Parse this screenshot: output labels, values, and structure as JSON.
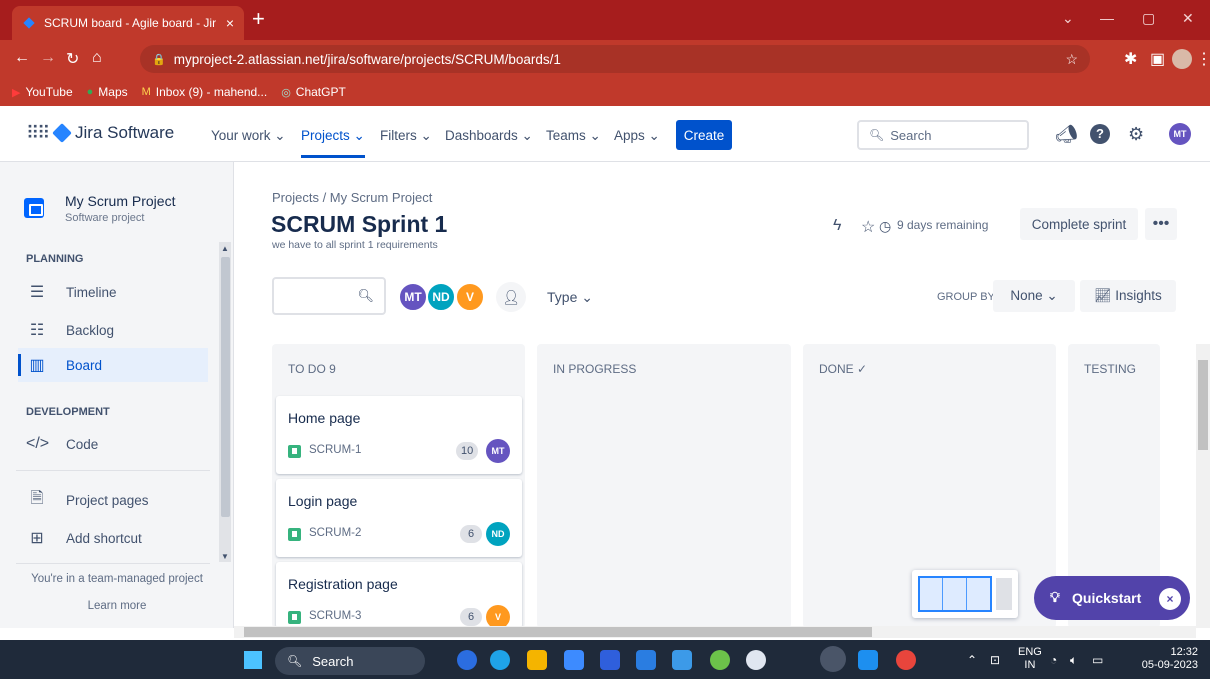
{
  "browser": {
    "tab_title": "SCRUM board - Agile board - Jir",
    "tab_close": "×",
    "new_tab": "+",
    "url": "myproject-2.atlassian.net/jira/software/projects/SCRUM/boards/1",
    "bookmarks": [
      "YouTube",
      "Maps",
      "Inbox (9) - mahend...",
      "ChatGPT"
    ]
  },
  "jira_nav": {
    "product": "Jira Software",
    "items": [
      "Your work ⌄",
      "Projects ⌄",
      "Filters ⌄",
      "Dashboards ⌄",
      "Teams ⌄",
      "Apps ⌄"
    ],
    "create": "Create",
    "search_placeholder": "Search",
    "user_initials": "MT"
  },
  "sidebar": {
    "project_name": "My Scrum Project",
    "project_type": "Software project",
    "planning_header": "PLANNING",
    "timeline": "Timeline",
    "backlog": "Backlog",
    "board": "Board",
    "development_header": "DEVELOPMENT",
    "code": "Code",
    "project_pages": "Project pages",
    "add_shortcut": "Add shortcut",
    "team_note": "You're in a team-managed project",
    "learn_more": "Learn more"
  },
  "board": {
    "breadcrumb": "Projects / My Scrum Project",
    "title": "SCRUM Sprint 1",
    "goal": "we have to all sprint 1 requirements",
    "remaining": "9 days remaining",
    "complete_sprint": "Complete sprint",
    "more": "•••",
    "avatars": [
      "MT",
      "ND",
      "V"
    ],
    "type_filter": "Type ⌄",
    "group_by_label": "GROUP BY",
    "group_by_value": "None ⌄",
    "insights": "Insights",
    "columns": [
      {
        "title": "TO DO 9"
      },
      {
        "title": "IN PROGRESS"
      },
      {
        "title": "DONE ✓"
      },
      {
        "title": "TESTING"
      }
    ],
    "cards": [
      {
        "title": "Home page",
        "key": "SCRUM-1",
        "points": "10",
        "assignee": "MT"
      },
      {
        "title": "Login page",
        "key": "SCRUM-2",
        "points": "6",
        "assignee": "ND"
      },
      {
        "title": "Registration page",
        "key": "SCRUM-3",
        "points": "6",
        "assignee": "V"
      }
    ],
    "quickstart": "Quickstart",
    "quickstart_close": "×"
  },
  "taskbar": {
    "search": "Search",
    "lang_top": "ENG",
    "lang_bottom": "IN",
    "time": "12:32",
    "date": "05-09-2023"
  },
  "colors": {
    "chrome_red": "#c0392b",
    "jira_blue": "#0052cc",
    "quickstart_purple": "#5243aa",
    "story_green": "#36b37e"
  }
}
